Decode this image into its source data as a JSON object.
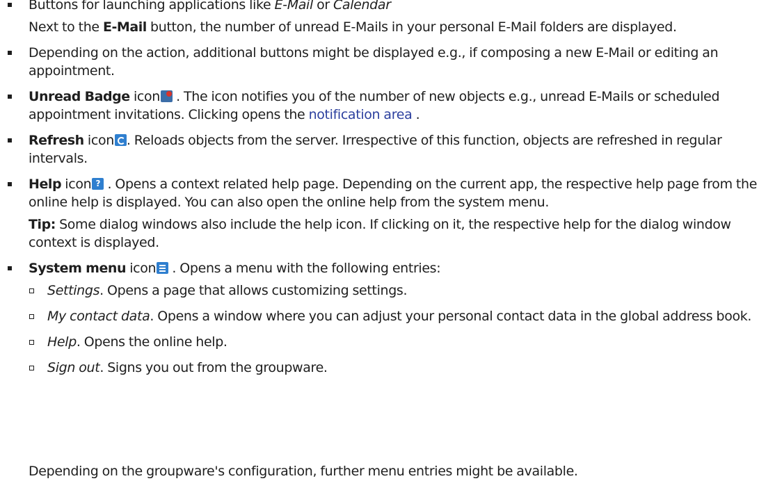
{
  "items": [
    {
      "pre": "Buttons for launching applications like ",
      "em1": "E-Mail",
      "mid": " or ",
      "em2": "Calendar"
    },
    {
      "note_pre": "Next to the ",
      "note_bold": "E-Mail",
      "note_post": " button, the number of unread E-Mails in your personal E-Mail folders are displayed."
    },
    {
      "text": "Depending on the action, additional buttons might be displayed e.g., if composing a new E-Mail or editing an appointment."
    },
    {
      "bold": "Unread Badge",
      "icon_word": " icon",
      "icon": "unread-badge-icon",
      "text1": " . The icon notifies you of the number of new objects e.g., unread E-Mails or scheduled appointment invitations. Clicking opens the ",
      "link": "notification area",
      "text2": " ."
    },
    {
      "bold": "Refresh",
      "icon_word": " icon",
      "icon": "refresh-icon",
      "text": ". Reloads objects from the server. Irrespective of this function, objects are refreshed in regular intervals."
    },
    {
      "bold": "Help",
      "icon_word": " icon",
      "icon": "help-icon",
      "text": " . Opens a context related help page. Depending on the current app, the respective help page from the online help is displayed. You can also open the online help from the system menu.",
      "tip_bold": "Tip:",
      "tip_text": " Some dialog windows also include the help icon. If clicking on it, the respective help for the dialog window context is displayed."
    },
    {
      "bold": "System menu",
      "icon_word": " icon",
      "icon": "menu-icon",
      "text": " . Opens a menu with the following entries:",
      "sub": [
        {
          "em": "Settings",
          "text": ". Opens a page that allows customizing settings."
        },
        {
          "em": "My contact data",
          "text": ". Opens a window where you can adjust your personal contact data in the global address book."
        },
        {
          "em": "Help",
          "text": ". Opens the online help."
        },
        {
          "em": "Sign out",
          "text": ". Signs you out from the groupware."
        }
      ]
    }
  ],
  "trailer": "Depending on the groupware's configuration, further menu entries might be available."
}
